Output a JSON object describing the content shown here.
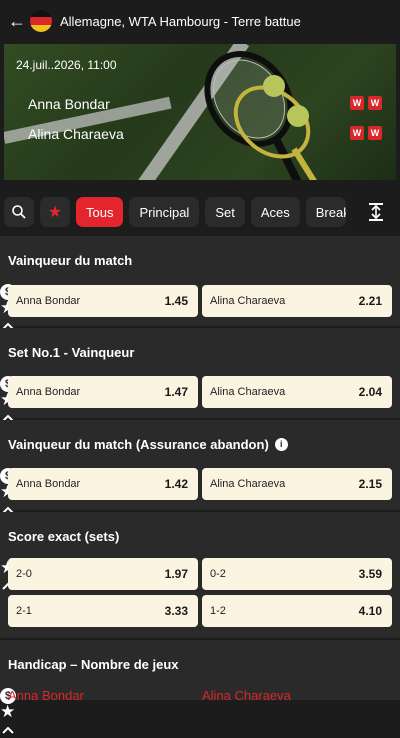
{
  "header": {
    "title": "Allemagne, WTA Hambourg - Terre battue",
    "flag_icon": "germany-flag-icon"
  },
  "event": {
    "date": "24.juil..2026, 11:00",
    "player1": "Anna Bondar",
    "player2": "Alina Charaeva",
    "form_badge": "W"
  },
  "filters": {
    "all": "Tous",
    "main": "Principal",
    "set": "Set",
    "aces": "Aces",
    "break": "Break"
  },
  "markets": [
    {
      "title": "Vainqueur du match",
      "o1_name": "Anna Bondar",
      "o1_val": "1.45",
      "o2_name": "Alina Charaeva",
      "o2_val": "2.21"
    },
    {
      "title": "Set No.1 - Vainqueur",
      "o1_name": "Anna Bondar",
      "o1_val": "1.47",
      "o2_name": "Alina Charaeva",
      "o2_val": "2.04"
    },
    {
      "title": "Vainqueur du match (Assurance abandon)",
      "o1_name": "Anna Bondar",
      "o1_val": "1.42",
      "o2_name": "Alina Charaeva",
      "o2_val": "2.15"
    },
    {
      "title": "Score exact (sets)",
      "rows": [
        {
          "a_name": "2-0",
          "a_val": "1.97",
          "b_name": "0-2",
          "b_val": "3.59"
        },
        {
          "a_name": "2-1",
          "a_val": "3.33",
          "b_name": "1-2",
          "b_val": "4.10"
        }
      ]
    },
    {
      "title": "Handicap – Nombre de jeux",
      "p1": "Anna Bondar",
      "p2": "Alina Charaeva"
    }
  ],
  "colors": {
    "accent": "#e3262d",
    "odds_bg": "#fbf4e0",
    "panel": "#2a2a2a"
  }
}
